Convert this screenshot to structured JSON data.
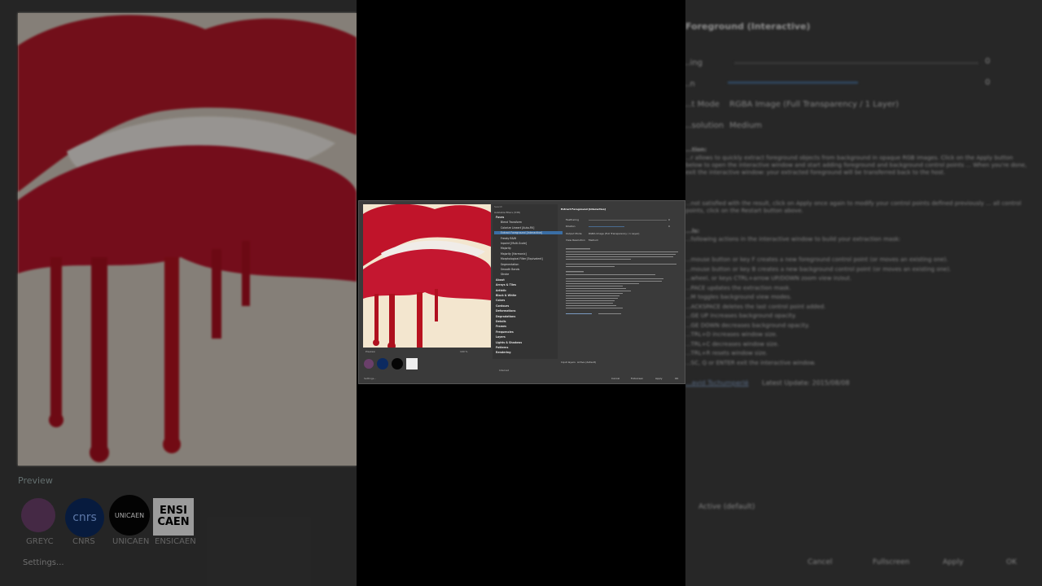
{
  "background": {
    "left_panel": {
      "preview_label": "Preview",
      "logos": [
        {
          "name": "GREYC"
        },
        {
          "name": "CNRS",
          "mark": "cnrs"
        },
        {
          "name": "UNICAEN",
          "mark": "UNICAEN"
        },
        {
          "name": "ENSICAEN",
          "mark": "ENSI CAEN"
        }
      ],
      "settings_label": "Settings..."
    },
    "right_panel": {
      "filter_title": "Foreground (Interactive)",
      "params": [
        {
          "label": "...ing",
          "value": "0"
        },
        {
          "label": "...n",
          "value": "0"
        }
      ],
      "output_mode_label": "...t Mode",
      "output_mode_value": "RGBA Image (Full Transparency / 1 Layer)",
      "resolution_label": "...solution",
      "resolution_value": "Medium",
      "description_heading": "...tion:",
      "description_text": "...r allows to quickly extract foreground objects from background in opaque RGB images. Click on the Apply button below to open the interactive window and start adding foreground and background control points ... When you're done, exit the interactive window: your extracted foreground will be transferred back to the host.",
      "note_text": "...not satisfied with the result, click on Apply once again to modify your control points defined previously ... all control points, click on the Restart button above.",
      "controls_heading": "...ls:",
      "controls_intro": "...following actions in the interactive window to build your extraction mask:",
      "controls": [
        "...mouse button or key F creates a new foreground control point (or moves an existing one).",
        "...mouse button or key B creates a new background control point (or moves an existing one).",
        "...wheel, or keys CTRL+arrow UP/DOWN zoom view in/out.",
        "...PACE updates the extraction mask.",
        "...M toggles background view modes.",
        "...ACKSPACE deletes the last control point added.",
        "...GE UP increases background opacity.",
        "...GE DOWN decreases background opacity.",
        "...TRL+D increases window size.",
        "...TRL+C decreases window size.",
        "...TRL+R resets window size.",
        "...SC, Q or ENTER exit the interactive window."
      ],
      "author_link": "...avid Tschumperlé",
      "latest_update": "Latest Update: 2015/08/08",
      "input_layers_value": "Active (default)",
      "buttons": [
        "Cancel",
        "Fullscreen",
        "Apply",
        "OK"
      ]
    }
  },
  "window": {
    "search_placeholder": "Search",
    "filter_count": "Available filters (538)",
    "tree": [
      {
        "label": "Faves",
        "bold": true
      },
      {
        "label": "Blend Transform",
        "indent": 2
      },
      {
        "label": "Colorize Lineart [Auto-Fill]",
        "indent": 2
      },
      {
        "label": "Extract Foreground [Interactive]",
        "indent": 2,
        "selected": true
      },
      {
        "label": "Freaky B&W",
        "indent": 2
      },
      {
        "label": "Inpaint [Multi-Scale]",
        "indent": 2
      },
      {
        "label": "Majority",
        "indent": 2
      },
      {
        "label": "Majority [Harmonic]",
        "indent": 2
      },
      {
        "label": "Morphological Filter [Equivalent]",
        "indent": 2
      },
      {
        "label": "Segmentation",
        "indent": 2
      },
      {
        "label": "Smooth Bands",
        "indent": 2
      },
      {
        "label": "Stroke",
        "indent": 2
      },
      {
        "label": "About",
        "bold": true
      },
      {
        "label": "Arrays & Tiles",
        "bold": true
      },
      {
        "label": "Artistic",
        "bold": true
      },
      {
        "label": "Black & White",
        "bold": true
      },
      {
        "label": "Colors",
        "bold": true
      },
      {
        "label": "Contours",
        "bold": true
      },
      {
        "label": "Deformations",
        "bold": true
      },
      {
        "label": "Degradations",
        "bold": true
      },
      {
        "label": "Details",
        "bold": true
      },
      {
        "label": "Frames",
        "bold": true
      },
      {
        "label": "Frequencies",
        "bold": true
      },
      {
        "label": "Layers",
        "bold": true
      },
      {
        "label": "Lights & Shadows",
        "bold": true
      },
      {
        "label": "Patterns",
        "bold": true
      },
      {
        "label": "Rendering",
        "bold": true
      }
    ],
    "filter_title": "Extract Foreground [Interactive]",
    "params": [
      {
        "label": "Feathering",
        "value": "0"
      },
      {
        "label": "Dilation",
        "value": "0"
      }
    ],
    "output_mode_label": "Output Mode",
    "output_mode_value": "RGBA Image (Full Transparency / 1 Layer)",
    "view_resolution_label": "View Resolution",
    "view_resolution_value": "Medium",
    "preview_label": "Preview",
    "zoom": "100 %",
    "internet_label": "Internet",
    "settings_label": "Settings...",
    "input_layers_label": "Input layers",
    "input_layers_value": "Active (default)",
    "buttons": [
      "Cancel",
      "Fullscreen",
      "Apply",
      "OK"
    ],
    "colors": {
      "accent": "#3a6ea5",
      "lip_red": "#c0142a",
      "canvas": "#f3e6cf",
      "panel": "#3a3a3a"
    }
  }
}
